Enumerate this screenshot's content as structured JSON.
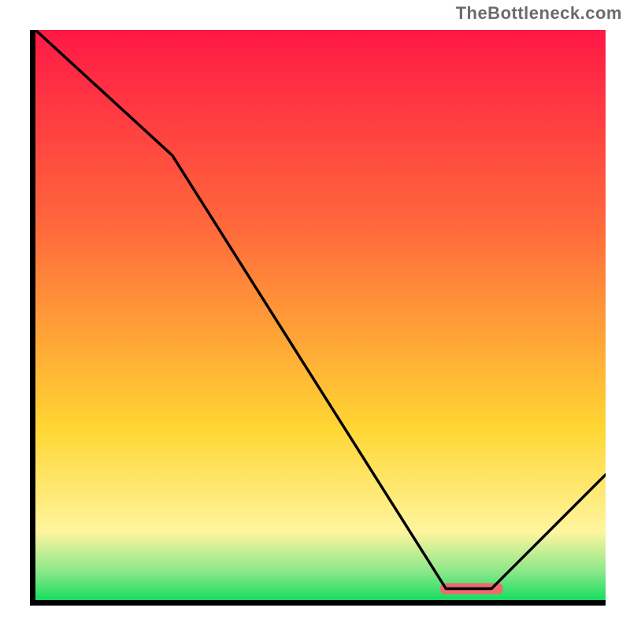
{
  "watermark": "TheBottleneck.com",
  "colors": {
    "gradient_top": "#ff1846",
    "gradient_upper": "#ff6a3b",
    "gradient_mid": "#ffd633",
    "gradient_lower_yellow": "#fff59e",
    "gradient_green_light": "#8be88a",
    "gradient_green": "#16dd5f",
    "axis": "#000000",
    "curve": "#000000",
    "marker": "#ef6a6f",
    "watermark_text": "#6b6b6b"
  },
  "chart_data": {
    "type": "line",
    "title": "",
    "xlabel": "",
    "ylabel": "",
    "xlim": [
      0,
      100
    ],
    "ylim": [
      0,
      100
    ],
    "x": [
      0,
      24,
      72,
      80,
      100
    ],
    "values": [
      100,
      78,
      2,
      2,
      22
    ],
    "marker_range_x": [
      71,
      82
    ],
    "marker_y": 2,
    "annotations": []
  }
}
